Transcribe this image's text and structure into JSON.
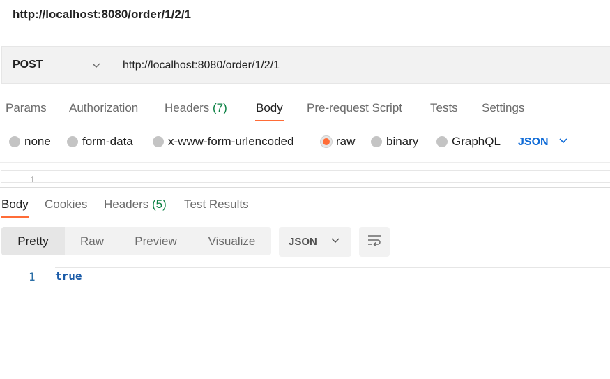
{
  "request_title": "http://localhost:8080/order/1/2/1",
  "request": {
    "method": "POST",
    "url": "http://localhost:8080/order/1/2/1"
  },
  "request_tabs": [
    {
      "label": "Params"
    },
    {
      "label": "Authorization"
    },
    {
      "label": "Headers",
      "count": "(7)"
    },
    {
      "label": "Body",
      "active": true
    },
    {
      "label": "Pre-request Script"
    },
    {
      "label": "Tests"
    },
    {
      "label": "Settings"
    }
  ],
  "body_types": [
    {
      "label": "none"
    },
    {
      "label": "form-data"
    },
    {
      "label": "x-www-form-urlencoded"
    },
    {
      "label": "raw",
      "selected": true
    },
    {
      "label": "binary"
    },
    {
      "label": "GraphQL"
    }
  ],
  "body_language": "JSON",
  "request_editor": {
    "line_number": "1"
  },
  "response_tabs": [
    {
      "label": "Body",
      "active": true
    },
    {
      "label": "Cookies"
    },
    {
      "label": "Headers",
      "count": "(5)"
    },
    {
      "label": "Test Results"
    }
  ],
  "response_views": [
    {
      "label": "Pretty",
      "active": true
    },
    {
      "label": "Raw"
    },
    {
      "label": "Preview"
    },
    {
      "label": "Visualize"
    }
  ],
  "response_format": "JSON",
  "response_output": {
    "line_number": "1",
    "value": "true"
  },
  "colors": {
    "accent": "#ff6c37",
    "link": "#0f6bd7",
    "count": "#0b8043"
  },
  "icons": [
    "chevron-down-icon",
    "wrap-lines-icon"
  ]
}
